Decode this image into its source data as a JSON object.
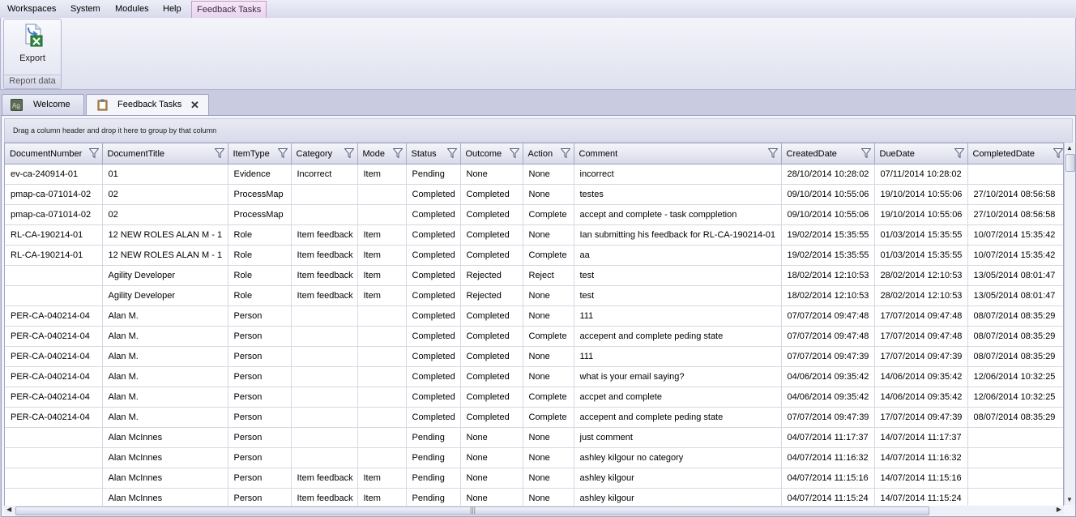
{
  "menu": {
    "items": [
      "Workspaces",
      "System",
      "Modules",
      "Help"
    ],
    "context_tab": "Feedback Tasks"
  },
  "ribbon": {
    "export_label": "Export",
    "group_label": "Report data"
  },
  "tabs": [
    {
      "label": "Welcome",
      "icon": "app-logo-icon"
    },
    {
      "label": "Feedback Tasks",
      "icon": "clipboard-icon",
      "close": "✕"
    }
  ],
  "grid": {
    "group_hint": "Drag a column header and drop it here to group by that column",
    "columns": [
      "DocumentNumber",
      "DocumentTitle",
      "ItemType",
      "Category",
      "Mode",
      "Status",
      "Outcome",
      "Action",
      "Comment",
      "CreatedDate",
      "DueDate",
      "CompletedDate"
    ],
    "rows": [
      [
        "ev-ca-240914-01",
        "01",
        "Evidence",
        "Incorrect",
        "Item",
        "Pending",
        "None",
        "None",
        "incorrect",
        "28/10/2014 10:28:02",
        "07/11/2014 10:28:02",
        ""
      ],
      [
        "pmap-ca-071014-02",
        "02",
        "ProcessMap",
        "",
        "",
        "Completed",
        "Completed",
        "None",
        "testes",
        "09/10/2014 10:55:06",
        "19/10/2014 10:55:06",
        "27/10/2014 08:56:58"
      ],
      [
        "pmap-ca-071014-02",
        "02",
        "ProcessMap",
        "",
        "",
        "Completed",
        "Completed",
        "Complete",
        "accept and complete  - task comppletion",
        "09/10/2014 10:55:06",
        "19/10/2014 10:55:06",
        "27/10/2014 08:56:58"
      ],
      [
        "RL-CA-190214-01",
        "12 NEW ROLES ALAN M - 1",
        "Role",
        "Item feedback",
        "Item",
        "Completed",
        "Completed",
        "None",
        "Ian submitting his feedback for RL-CA-190214-01",
        "19/02/2014 15:35:55",
        "01/03/2014 15:35:55",
        "10/07/2014 15:35:42"
      ],
      [
        "RL-CA-190214-01",
        "12 NEW ROLES ALAN M - 1",
        "Role",
        "Item feedback",
        "Item",
        "Completed",
        "Completed",
        "Complete",
        "aa",
        "19/02/2014 15:35:55",
        "01/03/2014 15:35:55",
        "10/07/2014 15:35:42"
      ],
      [
        "",
        "Agility Developer",
        "Role",
        "Item feedback",
        "Item",
        "Completed",
        "Rejected",
        "Reject",
        "test",
        "18/02/2014 12:10:53",
        "28/02/2014 12:10:53",
        "13/05/2014 08:01:47"
      ],
      [
        "",
        "Agility Developer",
        "Role",
        "Item feedback",
        "Item",
        "Completed",
        "Rejected",
        "None",
        "test",
        "18/02/2014 12:10:53",
        "28/02/2014 12:10:53",
        "13/05/2014 08:01:47"
      ],
      [
        "PER-CA-040214-04",
        "Alan M.",
        "Person",
        "",
        "",
        "Completed",
        "Completed",
        "None",
        "111",
        "07/07/2014 09:47:48",
        "17/07/2014 09:47:48",
        "08/07/2014 08:35:29"
      ],
      [
        "PER-CA-040214-04",
        "Alan M.",
        "Person",
        "",
        "",
        "Completed",
        "Completed",
        "Complete",
        "accepent and complete peding state",
        "07/07/2014 09:47:48",
        "17/07/2014 09:47:48",
        "08/07/2014 08:35:29"
      ],
      [
        "PER-CA-040214-04",
        "Alan M.",
        "Person",
        "",
        "",
        "Completed",
        "Completed",
        "None",
        "111",
        "07/07/2014 09:47:39",
        "17/07/2014 09:47:39",
        "08/07/2014 08:35:29"
      ],
      [
        "PER-CA-040214-04",
        "Alan M.",
        "Person",
        "",
        "",
        "Completed",
        "Completed",
        "None",
        "what is your email saying?",
        "04/06/2014 09:35:42",
        "14/06/2014 09:35:42",
        "12/06/2014 10:32:25"
      ],
      [
        "PER-CA-040214-04",
        "Alan M.",
        "Person",
        "",
        "",
        "Completed",
        "Completed",
        "Complete",
        "accpet and complete",
        "04/06/2014 09:35:42",
        "14/06/2014 09:35:42",
        "12/06/2014 10:32:25"
      ],
      [
        "PER-CA-040214-04",
        "Alan M.",
        "Person",
        "",
        "",
        "Completed",
        "Completed",
        "Complete",
        "accepent and complete peding state",
        "07/07/2014 09:47:39",
        "17/07/2014 09:47:39",
        "08/07/2014 08:35:29"
      ],
      [
        "",
        "Alan McInnes",
        "Person",
        "",
        "",
        "Pending",
        "None",
        "None",
        "just comment",
        "04/07/2014 11:17:37",
        "14/07/2014 11:17:37",
        ""
      ],
      [
        "",
        "Alan McInnes",
        "Person",
        "",
        "",
        "Pending",
        "None",
        "None",
        "ashley kilgour no category",
        "04/07/2014 11:16:32",
        "14/07/2014 11:16:32",
        ""
      ],
      [
        "",
        "Alan McInnes",
        "Person",
        "Item feedback",
        "Item",
        "Pending",
        "None",
        "None",
        "ashley kilgour",
        "04/07/2014 11:15:16",
        "14/07/2014 11:15:16",
        ""
      ],
      [
        "",
        "Alan McInnes",
        "Person",
        "Item feedback",
        "Item",
        "Pending",
        "None",
        "None",
        "ashley kilgour",
        "04/07/2014 11:15:24",
        "14/07/2014 11:15:24",
        ""
      ]
    ]
  }
}
